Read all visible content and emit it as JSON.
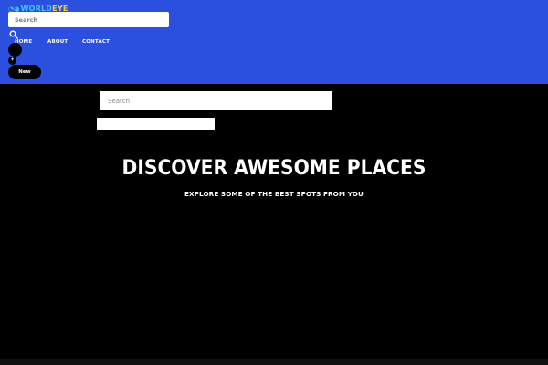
{
  "brand": {
    "logo_text_a": "WORLD",
    "logo_text_b": "EYE",
    "logo_mark": "◔◕"
  },
  "header": {
    "search_placeholder": "Search",
    "nav": [
      {
        "label": "HOME"
      },
      {
        "label": "ABOUT"
      },
      {
        "label": "CONTACT"
      }
    ],
    "plus_label": "+",
    "new_label": "New"
  },
  "main": {
    "search_placeholder": "Search",
    "title": "DISCOVER AWESOME PLACES",
    "subtitle": "EXPLORE SOME OF THE BEST SPOTS FROM YOU"
  },
  "colors": {
    "header_bg": "#2b50e0",
    "page_bg": "#000000",
    "text": "#ffffff"
  },
  "icons": {
    "search": "search-icon"
  }
}
